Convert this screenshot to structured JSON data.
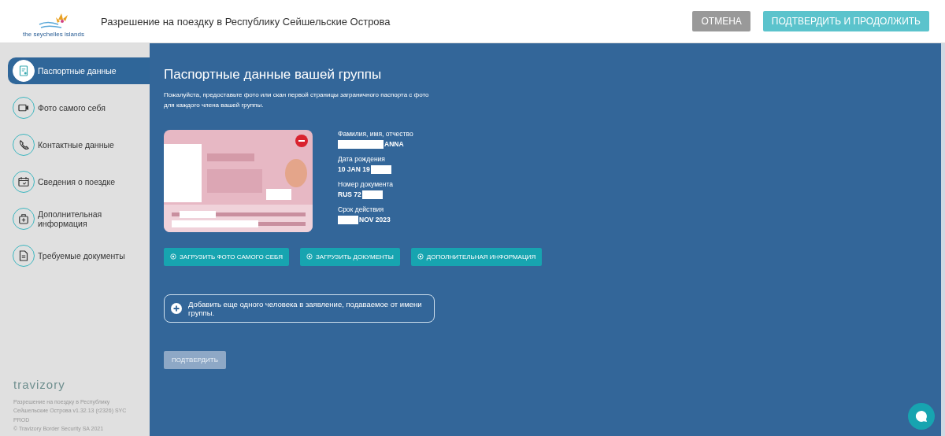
{
  "header": {
    "logo_text": "the seychelles islands",
    "title": "Разрешение на поездку в Республику Сейшельские Острова",
    "buttons": [
      {
        "label": "ОТМЕНА",
        "kind": "cancel"
      },
      {
        "label": "ПОДТВЕРДИТЬ И ПРОДОЛЖИТЬ",
        "kind": "confirm"
      }
    ]
  },
  "sidebar": {
    "items": [
      {
        "label": "Паспортные данные",
        "selected": true
      },
      {
        "label": "Фото самого себя",
        "selected": false
      },
      {
        "label": "Контактные данные",
        "selected": false
      },
      {
        "label": "Сведения о поездке",
        "selected": false
      },
      {
        "label": "Дополнительная информация",
        "selected": false
      },
      {
        "label": "Требуемые документы",
        "selected": false
      }
    ],
    "brand": "travizory",
    "footer": [
      "Разрешение на поездку в Республику Сейшельские Острова v1.32.13 (r2326) SYC PROD",
      "© Travizory Border Security SA 2021"
    ]
  },
  "main": {
    "title": "Паспортные данные вашей группы",
    "intro": "Пожалуйста, предоставьте фото или скан первой страницы заграничного паспорта с фото для каждого члена вашей группы.",
    "passport": {
      "fields": [
        {
          "label": "Фамилия, имя, отчество",
          "value": "ANNA",
          "kind": "masked_start"
        },
        {
          "label": "Дата рождения",
          "value": "10 JAN 19",
          "kind": "masked_end"
        },
        {
          "label": "Номер документа",
          "value": "RUS 72",
          "kind": "masked_end"
        },
        {
          "label": "Срок действия",
          "value": "NOV 2023",
          "kind": "masked_start"
        }
      ]
    },
    "actions": [
      "ЗАГРУЗИТЬ ФОТО САМОГО СЕБЯ",
      "ЗАГРУЗИТЬ ДОКУМЕНТЫ",
      "ДОПОЛНИТЕЛЬНАЯ ИНФОРМАЦИЯ"
    ],
    "add_person": "Добавить еще одного человека в заявление, подаваемое от имени группы.",
    "submit": {
      "label": "ПОДТВЕРДИТЬ",
      "disabled": true
    }
  }
}
